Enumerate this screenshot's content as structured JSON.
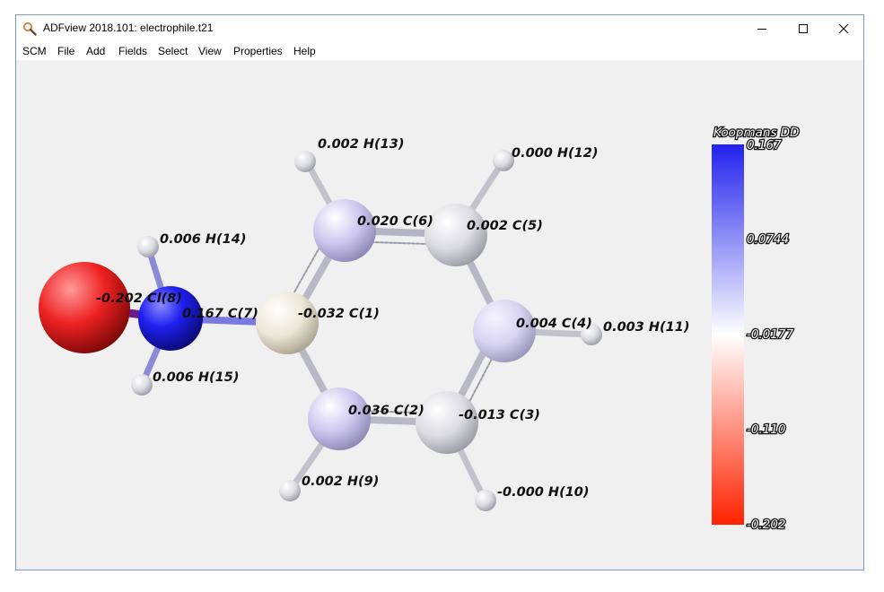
{
  "window": {
    "title": "ADFview 2018.101: electrophile.t21",
    "controls": [
      "minimize",
      "maximize",
      "close"
    ]
  },
  "menu": [
    "SCM",
    "File",
    "Add",
    "Fields",
    "Select",
    "View",
    "Properties",
    "Help"
  ],
  "labels": {
    "h13": "0.002 H(13)",
    "h12": "0.000 H(12)",
    "c6": "0.020 C(6)",
    "c5": "0.002 C(5)",
    "h14": "0.006 H(14)",
    "cl8": "-0.202 Cl(8)",
    "n7": "0.167 C(7)",
    "c1": "-0.032 C(1)",
    "c4": "0.004 C(4)",
    "h11": "0.003 H(11)",
    "h15": "0.006 H(15)",
    "c2": "0.036 C(2)",
    "c3": "-0.013 C(3)",
    "h9": "0.002 H(9)",
    "h10": "-0.000 H(10)"
  },
  "colorbar": {
    "title": "Koopmans DD",
    "ticks": [
      "0.167",
      "0.0744",
      "-0.0177",
      "-0.110",
      "-0.202"
    ],
    "colors": {
      "max": "#2222ee",
      "mid": "#ffffff",
      "min": "#ff2200"
    }
  }
}
